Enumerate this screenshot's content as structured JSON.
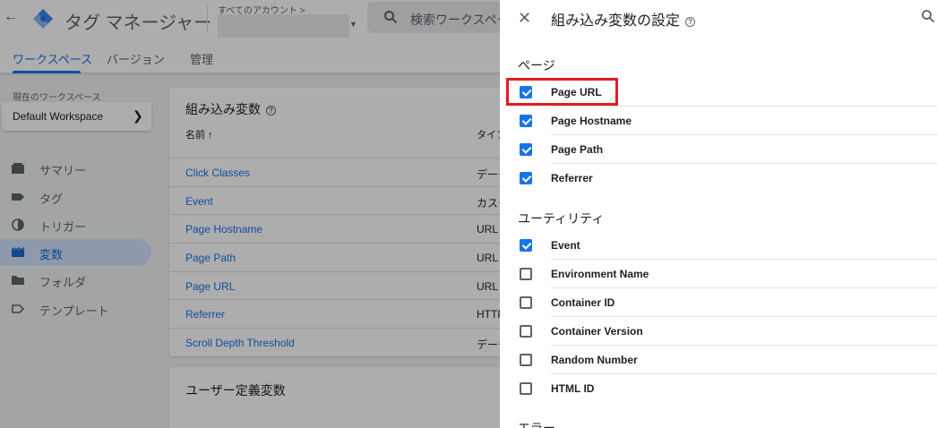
{
  "header": {
    "product_name": "タグ マネージャー",
    "account_label": "すべてのアカウント >",
    "search_placeholder": "検索ワークスペー"
  },
  "tabs": [
    {
      "label": "ワークスペース",
      "active": true
    },
    {
      "label": "バージョン",
      "active": false
    },
    {
      "label": "管理",
      "active": false
    }
  ],
  "sidebar": {
    "workspace_label": "現在のワークスペース",
    "workspace_name": "Default Workspace",
    "items": [
      {
        "label": "サマリー",
        "icon": "summary-icon",
        "active": false
      },
      {
        "label": "タグ",
        "icon": "tag-icon",
        "active": false
      },
      {
        "label": "トリガー",
        "icon": "trigger-icon",
        "active": false
      },
      {
        "label": "変数",
        "icon": "variables-icon",
        "active": true
      },
      {
        "label": "フォルダ",
        "icon": "folder-icon",
        "active": false
      },
      {
        "label": "テンプレート",
        "icon": "template-icon",
        "active": false
      }
    ]
  },
  "builtin_card": {
    "title": "組み込み変数",
    "col_name": "名前 ↑",
    "col_type": "タイプ",
    "rows": [
      {
        "name": "Click Classes",
        "type": "データ"
      },
      {
        "name": "Event",
        "type": "カスタ"
      },
      {
        "name": "Page Hostname",
        "type": "URL"
      },
      {
        "name": "Page Path",
        "type": "URL"
      },
      {
        "name": "Page URL",
        "type": "URL"
      },
      {
        "name": "Referrer",
        "type": "HTTP"
      },
      {
        "name": "Scroll Depth Threshold",
        "type": "データ"
      }
    ]
  },
  "user_card": {
    "title": "ユーザー定義変数"
  },
  "panel": {
    "title": "組み込み変数の設定",
    "sections": [
      {
        "title": "ページ",
        "items": [
          {
            "label": "Page URL",
            "checked": true
          },
          {
            "label": "Page Hostname",
            "checked": true
          },
          {
            "label": "Page Path",
            "checked": true
          },
          {
            "label": "Referrer",
            "checked": true
          }
        ]
      },
      {
        "title": "ユーティリティ",
        "items": [
          {
            "label": "Event",
            "checked": true
          },
          {
            "label": "Environment Name",
            "checked": false
          },
          {
            "label": "Container ID",
            "checked": false
          },
          {
            "label": "Container Version",
            "checked": false
          },
          {
            "label": "Random Number",
            "checked": false
          },
          {
            "label": "HTML ID",
            "checked": false
          }
        ]
      },
      {
        "title": "エラー",
        "items": []
      }
    ]
  },
  "colors": {
    "accent": "#1a73e8",
    "highlight": "#e31c23",
    "nav_active_bg": "#d2e3fc"
  }
}
